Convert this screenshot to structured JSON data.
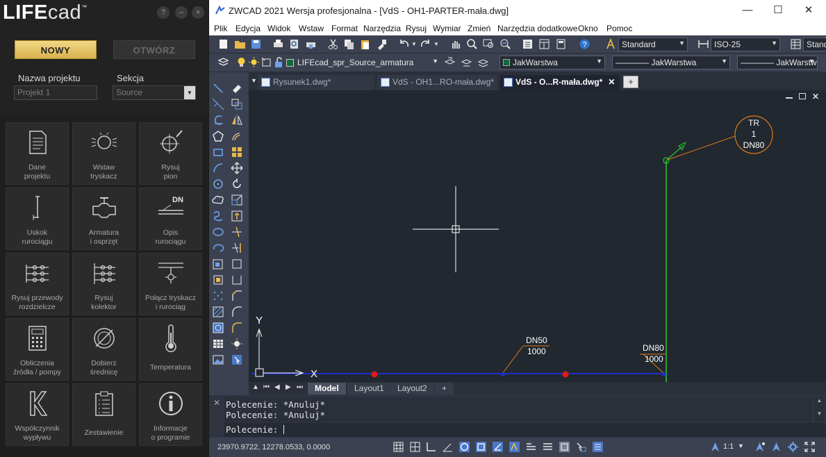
{
  "lifecad": {
    "logo_bold": "LIFE",
    "logo_light": "cad",
    "logo_tm": "™",
    "help_icon": "?",
    "minimize_icon": "–",
    "close_icon": "×",
    "btn_new": "NOWY",
    "btn_open": "OTWÓRZ",
    "project_name_label": "Nazwa projektu",
    "project_name_placeholder": "Projekt 1",
    "section_label": "Sekcja",
    "section_value": "Source",
    "tiles": [
      {
        "line1": "Dane",
        "line2": "projektu",
        "icon": "document-icon"
      },
      {
        "line1": "Wstaw",
        "line2": "tryskacz",
        "icon": "sprinkler-icon"
      },
      {
        "line1": "Rysuj",
        "line2": "pion",
        "icon": "riser-icon"
      },
      {
        "line1": "Uskok",
        "line2": "rurociągu",
        "icon": "pipe-offset-icon"
      },
      {
        "line1": "Armatura",
        "line2": "i osprzęt",
        "icon": "valve-icon"
      },
      {
        "line1": "Opis",
        "line2": "rurociągu",
        "icon": "pipe-label-icon"
      },
      {
        "line1": "Rysuj przewody",
        "line2": "rozdzielcze",
        "icon": "distribution-lines-icon"
      },
      {
        "line1": "Rysuj",
        "line2": "kolektor",
        "icon": "manifold-icon"
      },
      {
        "line1": "Połącz tryskacz",
        "line2": "i rurociąg",
        "icon": "connect-sprinkler-icon"
      },
      {
        "line1": "Obliczenia",
        "line2": "źródła / pompy",
        "icon": "calculator-icon"
      },
      {
        "line1": "Dobierz",
        "line2": "średnicę",
        "icon": "diameter-icon"
      },
      {
        "line1": "Temperatura",
        "line2": "",
        "icon": "thermometer-icon"
      },
      {
        "line1": "Współczynnik",
        "line2": "wypływu",
        "icon": "k-factor-icon"
      },
      {
        "line1": "Zestawienie",
        "line2": "",
        "icon": "clipboard-list-icon"
      },
      {
        "line1": "Informacje",
        "line2": "o programie",
        "icon": "info-icon"
      }
    ],
    "tile_icon_dn": "DN"
  },
  "zwcad": {
    "title": "ZWCAD 2021 Wersja profesjonalna - [VdS - OH1-PARTER-mała.dwg]",
    "menu": [
      "Plik",
      "Edycja",
      "Widok",
      "Wstaw",
      "Format",
      "Narzędzia",
      "Rysuj",
      "Wymiar",
      "Zmień",
      "Narzędzia dodatkowe",
      "Okno",
      "Pomoc"
    ],
    "text_style": "Standard",
    "dim_style": "ISO-25",
    "table_style": "Standard",
    "layer": "LIFEcad_spr_Source_armatura",
    "color": "JakWarstwa",
    "linetype_prefix": "————",
    "linetype": "JakWarstwa",
    "lineweight_prefix": "————",
    "lineweight": "JakWarstwa",
    "doc_tabs": [
      "Rysunek1.dwg*",
      "VdS - OH1...RO-mała.dwg*",
      "VdS - O...R-mała.dwg*"
    ],
    "active_doc_tab": 2,
    "new_tab_icon": "+",
    "layout_tabs": [
      "Model",
      "Layout1",
      "Layout2",
      "+"
    ],
    "command_history": [
      "Polecenie: *Anuluj*",
      "Polecenie: *Anuluj*"
    ],
    "command_prompt": "Polecenie:",
    "coords": "23970.9722, 12278.0533, 0.0000",
    "scale": "1:1",
    "colors": {
      "pipe_blue": "#1f2fc8",
      "riser_green": "#2ec52e",
      "label_orange": "#e07a1c",
      "node_red": "#e01818",
      "canvas_bg": "#212830"
    }
  },
  "drawing": {
    "ucs_y": "Y",
    "ucs_x": "X",
    "label_dn50_top": "DN50",
    "label_dn50_bottom": "1000",
    "label_dn80_top": "DN80",
    "label_dn80_bottom": "1000",
    "bubble_line1": "TR",
    "bubble_line2": "1",
    "bubble_line3": "DN80"
  }
}
